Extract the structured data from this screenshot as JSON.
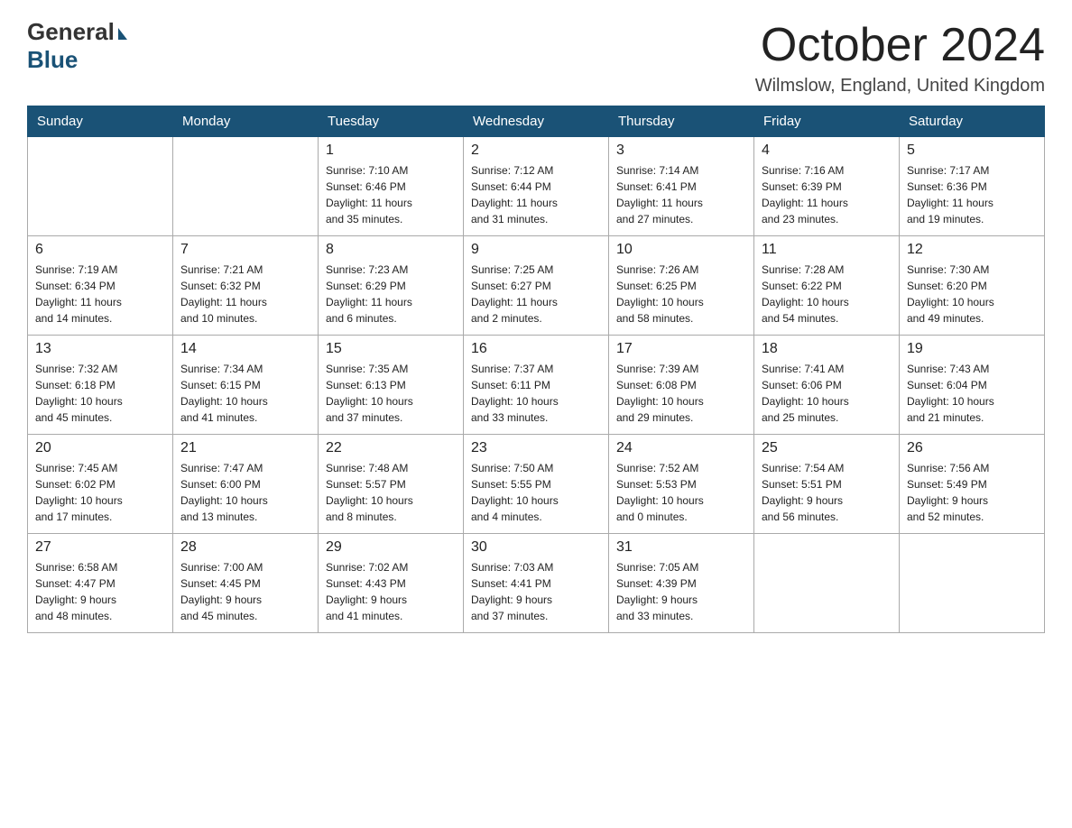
{
  "logo": {
    "general": "General",
    "blue": "Blue"
  },
  "title": "October 2024",
  "location": "Wilmslow, England, United Kingdom",
  "days_of_week": [
    "Sunday",
    "Monday",
    "Tuesday",
    "Wednesday",
    "Thursday",
    "Friday",
    "Saturday"
  ],
  "weeks": [
    [
      {
        "day": "",
        "info": ""
      },
      {
        "day": "",
        "info": ""
      },
      {
        "day": "1",
        "info": "Sunrise: 7:10 AM\nSunset: 6:46 PM\nDaylight: 11 hours\nand 35 minutes."
      },
      {
        "day": "2",
        "info": "Sunrise: 7:12 AM\nSunset: 6:44 PM\nDaylight: 11 hours\nand 31 minutes."
      },
      {
        "day": "3",
        "info": "Sunrise: 7:14 AM\nSunset: 6:41 PM\nDaylight: 11 hours\nand 27 minutes."
      },
      {
        "day": "4",
        "info": "Sunrise: 7:16 AM\nSunset: 6:39 PM\nDaylight: 11 hours\nand 23 minutes."
      },
      {
        "day": "5",
        "info": "Sunrise: 7:17 AM\nSunset: 6:36 PM\nDaylight: 11 hours\nand 19 minutes."
      }
    ],
    [
      {
        "day": "6",
        "info": "Sunrise: 7:19 AM\nSunset: 6:34 PM\nDaylight: 11 hours\nand 14 minutes."
      },
      {
        "day": "7",
        "info": "Sunrise: 7:21 AM\nSunset: 6:32 PM\nDaylight: 11 hours\nand 10 minutes."
      },
      {
        "day": "8",
        "info": "Sunrise: 7:23 AM\nSunset: 6:29 PM\nDaylight: 11 hours\nand 6 minutes."
      },
      {
        "day": "9",
        "info": "Sunrise: 7:25 AM\nSunset: 6:27 PM\nDaylight: 11 hours\nand 2 minutes."
      },
      {
        "day": "10",
        "info": "Sunrise: 7:26 AM\nSunset: 6:25 PM\nDaylight: 10 hours\nand 58 minutes."
      },
      {
        "day": "11",
        "info": "Sunrise: 7:28 AM\nSunset: 6:22 PM\nDaylight: 10 hours\nand 54 minutes."
      },
      {
        "day": "12",
        "info": "Sunrise: 7:30 AM\nSunset: 6:20 PM\nDaylight: 10 hours\nand 49 minutes."
      }
    ],
    [
      {
        "day": "13",
        "info": "Sunrise: 7:32 AM\nSunset: 6:18 PM\nDaylight: 10 hours\nand 45 minutes."
      },
      {
        "day": "14",
        "info": "Sunrise: 7:34 AM\nSunset: 6:15 PM\nDaylight: 10 hours\nand 41 minutes."
      },
      {
        "day": "15",
        "info": "Sunrise: 7:35 AM\nSunset: 6:13 PM\nDaylight: 10 hours\nand 37 minutes."
      },
      {
        "day": "16",
        "info": "Sunrise: 7:37 AM\nSunset: 6:11 PM\nDaylight: 10 hours\nand 33 minutes."
      },
      {
        "day": "17",
        "info": "Sunrise: 7:39 AM\nSunset: 6:08 PM\nDaylight: 10 hours\nand 29 minutes."
      },
      {
        "day": "18",
        "info": "Sunrise: 7:41 AM\nSunset: 6:06 PM\nDaylight: 10 hours\nand 25 minutes."
      },
      {
        "day": "19",
        "info": "Sunrise: 7:43 AM\nSunset: 6:04 PM\nDaylight: 10 hours\nand 21 minutes."
      }
    ],
    [
      {
        "day": "20",
        "info": "Sunrise: 7:45 AM\nSunset: 6:02 PM\nDaylight: 10 hours\nand 17 minutes."
      },
      {
        "day": "21",
        "info": "Sunrise: 7:47 AM\nSunset: 6:00 PM\nDaylight: 10 hours\nand 13 minutes."
      },
      {
        "day": "22",
        "info": "Sunrise: 7:48 AM\nSunset: 5:57 PM\nDaylight: 10 hours\nand 8 minutes."
      },
      {
        "day": "23",
        "info": "Sunrise: 7:50 AM\nSunset: 5:55 PM\nDaylight: 10 hours\nand 4 minutes."
      },
      {
        "day": "24",
        "info": "Sunrise: 7:52 AM\nSunset: 5:53 PM\nDaylight: 10 hours\nand 0 minutes."
      },
      {
        "day": "25",
        "info": "Sunrise: 7:54 AM\nSunset: 5:51 PM\nDaylight: 9 hours\nand 56 minutes."
      },
      {
        "day": "26",
        "info": "Sunrise: 7:56 AM\nSunset: 5:49 PM\nDaylight: 9 hours\nand 52 minutes."
      }
    ],
    [
      {
        "day": "27",
        "info": "Sunrise: 6:58 AM\nSunset: 4:47 PM\nDaylight: 9 hours\nand 48 minutes."
      },
      {
        "day": "28",
        "info": "Sunrise: 7:00 AM\nSunset: 4:45 PM\nDaylight: 9 hours\nand 45 minutes."
      },
      {
        "day": "29",
        "info": "Sunrise: 7:02 AM\nSunset: 4:43 PM\nDaylight: 9 hours\nand 41 minutes."
      },
      {
        "day": "30",
        "info": "Sunrise: 7:03 AM\nSunset: 4:41 PM\nDaylight: 9 hours\nand 37 minutes."
      },
      {
        "day": "31",
        "info": "Sunrise: 7:05 AM\nSunset: 4:39 PM\nDaylight: 9 hours\nand 33 minutes."
      },
      {
        "day": "",
        "info": ""
      },
      {
        "day": "",
        "info": ""
      }
    ]
  ]
}
